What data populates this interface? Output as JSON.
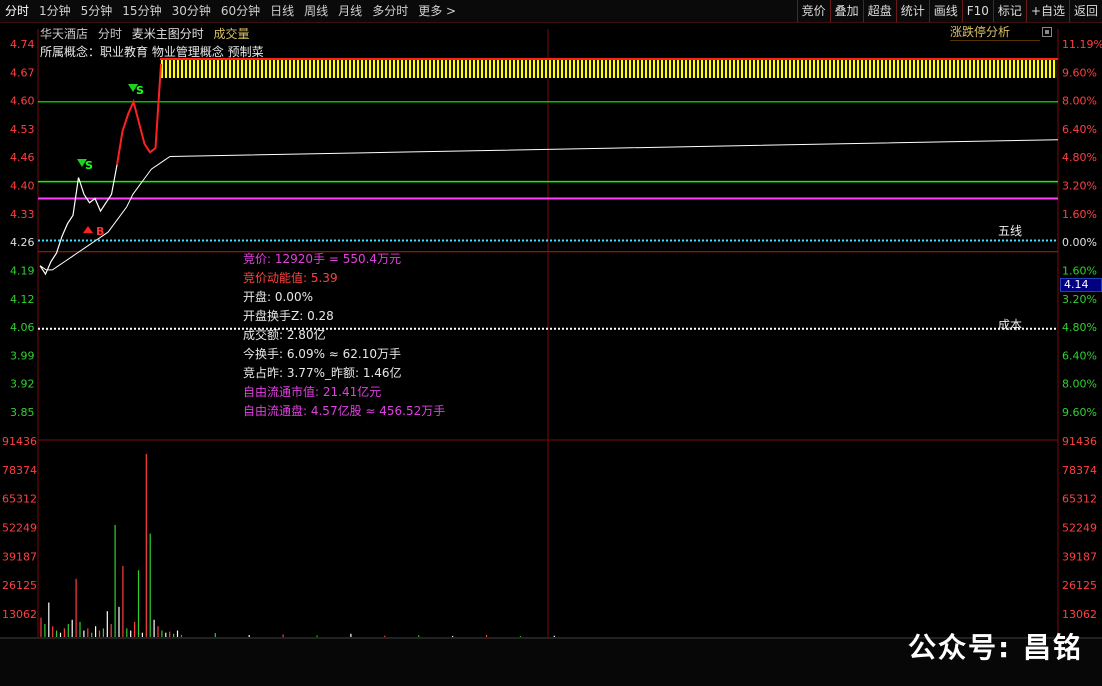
{
  "tabs": [
    "分时",
    "1分钟",
    "5分钟",
    "15分钟",
    "30分钟",
    "60分钟",
    "日线",
    "周线",
    "月线",
    "多分时",
    "更多 >"
  ],
  "tools": [
    "竞价",
    "叠加",
    "超盘",
    "统计",
    "画线",
    "F10",
    "标记",
    "+自选",
    "返回"
  ],
  "header": {
    "stock_name": "华天酒店",
    "mode": "分时",
    "template": "麦米主图分时",
    "indicator": "成交量",
    "concepts": "所属概念：职业教育 物业管理概念 预制菜",
    "ladder": "涨跌停分析"
  },
  "price_axis_left": [
    "4.74",
    "4.67",
    "4.60",
    "4.53",
    "4.46",
    "4.40",
    "4.33",
    "4.26",
    "4.19",
    "4.12",
    "4.06",
    "3.99",
    "3.92",
    "3.85"
  ],
  "pct_axis_right": [
    "11.19%",
    "9.60%",
    "8.00%",
    "6.40%",
    "4.80%",
    "3.20%",
    "1.60%",
    "0.00%",
    "1.60%",
    "3.20%",
    "4.80%",
    "6.40%",
    "8.00%",
    "9.60%"
  ],
  "vol_axis": [
    "91436",
    "78374",
    "65312",
    "52249",
    "39187",
    "26125",
    "13062"
  ],
  "current_price_tag": "4.14",
  "line_labels": {
    "wuxian": "五线",
    "chengben": "成本"
  },
  "markers": {
    "sell": "S",
    "buy": "B"
  },
  "info": {
    "bid_price": "竞价: 12920手 = 550.4万元",
    "bid_energy": "竞价动能值: 5.39",
    "open": "开盘: 0.00%",
    "open_turnover": "开盘换手Z: 0.28",
    "amount": "成交额: 2.80亿",
    "today_turnover": "今换手: 6.09% ≈ 62.10万手",
    "bid_ratio": "竞占昨: 3.77%_昨额: 1.46亿",
    "float_value": "自由流通市值: 21.41亿元",
    "float_shares": "自由流通盘: 4.57亿股 ≈ 456.52万手"
  },
  "watermark": "公众号: 昌铭",
  "colors": {
    "limit_up_fill": "#ffff00",
    "price_line_red": "#ff2020",
    "avg_line": "#ffffff",
    "green_line": "#00ff00",
    "magenta_line": "#ff40ff",
    "cyan_dotted": "#40e0ff",
    "grid_red": "#7a0a0a"
  },
  "chart_data": {
    "type": "line",
    "title": "",
    "price_range": [
      3.85,
      4.74
    ],
    "prev_close": 4.26,
    "limit_up": 4.69,
    "reference_lines": {
      "green_top": 4.6,
      "green_mid": 4.41,
      "magenta": 4.37,
      "cyan": 4.27,
      "cost": 4.06
    },
    "price_series": [
      4.21,
      4.19,
      4.22,
      4.24,
      4.28,
      4.31,
      4.33,
      4.42,
      4.38,
      4.36,
      4.37,
      4.34,
      4.36,
      4.38,
      4.45,
      4.53,
      4.57,
      4.6,
      4.55,
      4.5,
      4.48,
      4.49,
      4.69
    ],
    "avg_series": [
      4.21,
      4.2,
      4.2,
      4.21,
      4.22,
      4.23,
      4.24,
      4.25,
      4.26,
      4.27,
      4.28,
      4.29,
      4.31,
      4.33,
      4.35,
      4.38,
      4.4,
      4.42,
      4.44,
      4.45,
      4.46,
      4.47,
      4.48,
      4.49,
      4.5,
      4.51
    ],
    "volume_range": [
      0,
      91436
    ],
    "volumes": [
      9000,
      6000,
      16000,
      5000,
      3000,
      2000,
      4000,
      6000,
      8000,
      27000,
      7000,
      3000,
      4000,
      2000,
      5000,
      3000,
      4000,
      12000,
      6000,
      52000,
      14000,
      33000,
      4000,
      3000,
      7000,
      31000,
      2000,
      85000,
      48000,
      8000,
      5000,
      3000,
      2000,
      2500,
      1500,
      3000,
      1000,
      1800,
      900,
      1200,
      700,
      1500,
      600,
      800,
      500,
      1000,
      400,
      600
    ]
  }
}
